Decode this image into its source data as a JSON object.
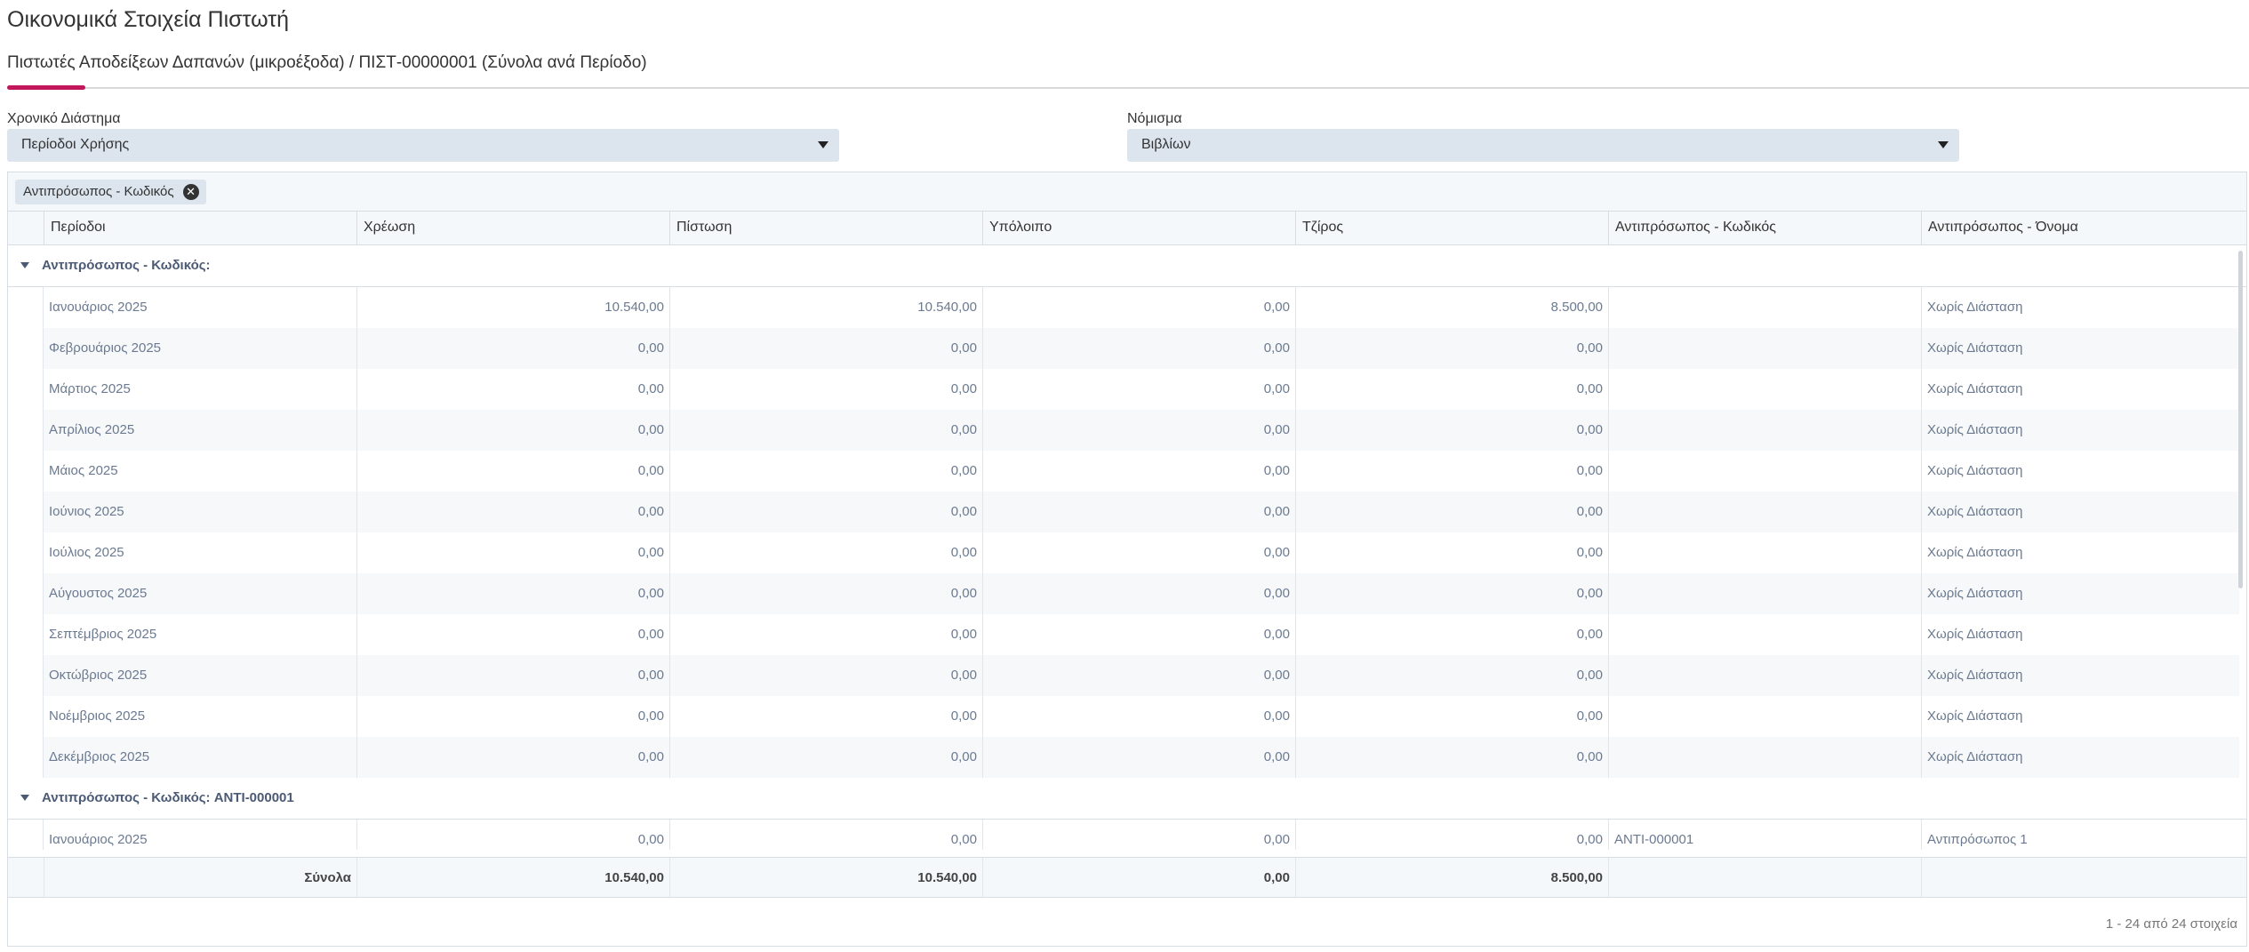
{
  "page": {
    "title": "Οικονομικά Στοιχεία Πιστωτή",
    "subtitle": "Πιστωτές Αποδείξεων Δαπανών (μικροέξοδα) / ΠΙΣΤ-00000001 (Σύνολα ανά Περίοδο)"
  },
  "filters": {
    "period_label": "Χρονικό Διάστημα",
    "period_value": "Περίοδοι Χρήσης",
    "currency_label": "Νόμισμα",
    "currency_value": "Βιβλίων"
  },
  "grouping": {
    "chip_label": "Αντιπρόσωπος - Κωδικός"
  },
  "columns": [
    "Περίοδοι",
    "Χρέωση",
    "Πίστωση",
    "Υπόλοιπο",
    "Τζίρος",
    "Αντιπρόσωπος - Κωδικός",
    "Αντιπρόσωπος - Όνομα"
  ],
  "groups": [
    {
      "label": "Αντιπρόσωπος - Κωδικός:",
      "rows": [
        {
          "period": "Ιανουάριος 2025",
          "debit": "10.540,00",
          "credit": "10.540,00",
          "balance": "0,00",
          "turnover": "8.500,00",
          "code": "",
          "name": "Χωρίς Διάσταση"
        },
        {
          "period": "Φεβρουάριος 2025",
          "debit": "0,00",
          "credit": "0,00",
          "balance": "0,00",
          "turnover": "0,00",
          "code": "",
          "name": "Χωρίς Διάσταση"
        },
        {
          "period": "Μάρτιος 2025",
          "debit": "0,00",
          "credit": "0,00",
          "balance": "0,00",
          "turnover": "0,00",
          "code": "",
          "name": "Χωρίς Διάσταση"
        },
        {
          "period": "Απρίλιος 2025",
          "debit": "0,00",
          "credit": "0,00",
          "balance": "0,00",
          "turnover": "0,00",
          "code": "",
          "name": "Χωρίς Διάσταση"
        },
        {
          "period": "Μάιος 2025",
          "debit": "0,00",
          "credit": "0,00",
          "balance": "0,00",
          "turnover": "0,00",
          "code": "",
          "name": "Χωρίς Διάσταση"
        },
        {
          "period": "Ιούνιος 2025",
          "debit": "0,00",
          "credit": "0,00",
          "balance": "0,00",
          "turnover": "0,00",
          "code": "",
          "name": "Χωρίς Διάσταση"
        },
        {
          "period": "Ιούλιος 2025",
          "debit": "0,00",
          "credit": "0,00",
          "balance": "0,00",
          "turnover": "0,00",
          "code": "",
          "name": "Χωρίς Διάσταση"
        },
        {
          "period": "Αύγουστος 2025",
          "debit": "0,00",
          "credit": "0,00",
          "balance": "0,00",
          "turnover": "0,00",
          "code": "",
          "name": "Χωρίς Διάσταση"
        },
        {
          "period": "Σεπτέμβριος 2025",
          "debit": "0,00",
          "credit": "0,00",
          "balance": "0,00",
          "turnover": "0,00",
          "code": "",
          "name": "Χωρίς Διάσταση"
        },
        {
          "period": "Οκτώβριος 2025",
          "debit": "0,00",
          "credit": "0,00",
          "balance": "0,00",
          "turnover": "0,00",
          "code": "",
          "name": "Χωρίς Διάσταση"
        },
        {
          "period": "Νοέμβριος 2025",
          "debit": "0,00",
          "credit": "0,00",
          "balance": "0,00",
          "turnover": "0,00",
          "code": "",
          "name": "Χωρίς Διάσταση"
        },
        {
          "period": "Δεκέμβριος 2025",
          "debit": "0,00",
          "credit": "0,00",
          "balance": "0,00",
          "turnover": "0,00",
          "code": "",
          "name": "Χωρίς Διάσταση"
        }
      ]
    },
    {
      "label": "Αντιπρόσωπος - Κωδικός: ANTI-000001",
      "rows": [
        {
          "period": "Ιανουάριος 2025",
          "debit": "0,00",
          "credit": "0,00",
          "balance": "0,00",
          "turnover": "0,00",
          "code": "ANTI-000001",
          "name": "Αντιπρόσωπος 1"
        }
      ]
    }
  ],
  "totals": {
    "label": "Σύνολα",
    "debit": "10.540,00",
    "credit": "10.540,00",
    "balance": "0,00",
    "turnover": "8.500,00"
  },
  "pager": {
    "text": "1 - 24 από 24 στοιχεία"
  }
}
